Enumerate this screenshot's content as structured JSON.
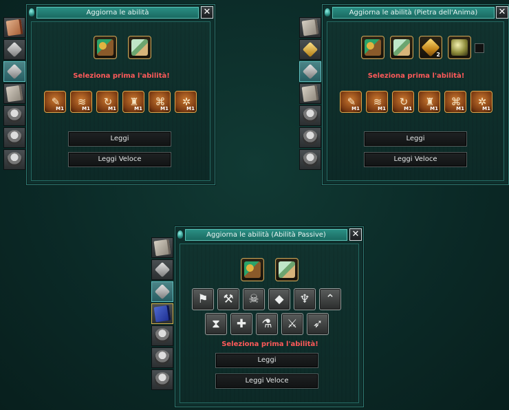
{
  "windows": {
    "skills": {
      "title": "Aggiorna le abilità",
      "close_label": "✕",
      "warning": "Seleziona prima l'abilità!",
      "read_button": "Leggi",
      "read_fast_button": "Leggi Veloce",
      "skills": [
        {
          "icon": "scroll-skill-icon",
          "level": "M1"
        },
        {
          "icon": "dragon-skill-icon",
          "level": "M1"
        },
        {
          "icon": "whirl-skill-icon",
          "level": "M1"
        },
        {
          "icon": "body-skill-icon",
          "level": "M1"
        },
        {
          "icon": "rune-skill-icon",
          "level": "M1"
        },
        {
          "icon": "blade-spin-skill-icon",
          "level": "M1"
        }
      ]
    },
    "soulstone": {
      "title": "Aggiorna le abilità (Pietra dell'Anima)",
      "close_label": "✕",
      "warning": "Seleziona prima l'abilità!",
      "read_button": "Leggi",
      "read_fast_button": "Leggi Veloce",
      "soulstone_count": "2",
      "skills": [
        {
          "icon": "scroll-skill-icon",
          "level": "M1"
        },
        {
          "icon": "dragon-skill-icon",
          "level": "M1"
        },
        {
          "icon": "whirl-skill-icon",
          "level": "M1"
        },
        {
          "icon": "body-skill-icon",
          "level": "M1"
        },
        {
          "icon": "rune-skill-icon",
          "level": "M1"
        },
        {
          "icon": "blade-spin-skill-icon",
          "level": "M1"
        }
      ]
    },
    "passive": {
      "title": "Aggiorna le abilità (Abilità Passive)",
      "close_label": "✕",
      "warning": "Seleziona prima l'abilità!",
      "read_button": "Leggi",
      "read_fast_button": "Leggi Veloce",
      "passives_row1": [
        "flag-icon",
        "pickaxe-icon",
        "skull-icon",
        "ore-icon",
        "trident-icon",
        "rank-chevron-icon"
      ],
      "passives_row2": [
        "hourglass-icon",
        "shield-cross-icon",
        "flask-icon",
        "anvil-hammer-icon",
        "bow-icon"
      ]
    }
  },
  "colors": {
    "warning": "#ff5a5a",
    "title_bar": "#2a8e83",
    "skill_border": "#e0a64a"
  }
}
